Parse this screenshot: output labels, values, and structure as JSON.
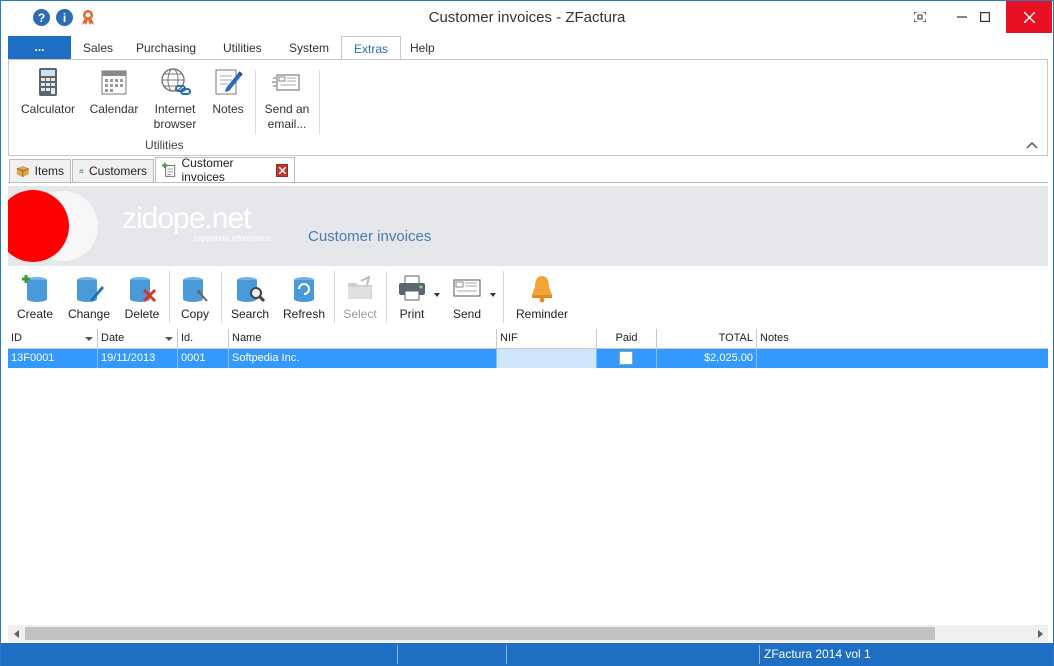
{
  "window": {
    "title": "Customer invoices - ZFactura"
  },
  "menu": {
    "file_label": "...",
    "items": [
      "Sales",
      "Purchasing",
      "Utilities",
      "System",
      "Extras",
      "Help"
    ],
    "active": "Extras"
  },
  "ribbon": {
    "buttons": [
      {
        "label": "Calculator"
      },
      {
        "label": "Calendar"
      },
      {
        "label": "Internet browser"
      },
      {
        "label": "Notes"
      },
      {
        "label": "Send an email..."
      }
    ],
    "group_label": "Utilities"
  },
  "doc_tabs": [
    {
      "label": "Items"
    },
    {
      "label": "Customers"
    },
    {
      "label": "Customer invoices"
    }
  ],
  "banner": {
    "logo_text": "zidope.net",
    "logo_sub": "ingeniería informática",
    "title": "Customer invoices"
  },
  "toolbar": {
    "buttons": [
      {
        "label": "Create"
      },
      {
        "label": "Change"
      },
      {
        "label": "Delete"
      },
      {
        "label": "Copy"
      },
      {
        "label": "Search"
      },
      {
        "label": "Refresh"
      },
      {
        "label": "Select"
      },
      {
        "label": "Print"
      },
      {
        "label": "Send"
      },
      {
        "label": "Reminder"
      }
    ]
  },
  "grid": {
    "columns": [
      "ID",
      "Date",
      "Id.",
      "Name",
      "NIF",
      "Paid",
      "TOTAL",
      "Notes"
    ],
    "rows": [
      {
        "id": "13F0001",
        "date": "19/11/2013",
        "idn": "0001",
        "name": "Softpedia Inc.",
        "nif": "",
        "paid": false,
        "total": "$2,025.00",
        "notes": ""
      }
    ]
  },
  "status": {
    "text": "ZFactura 2014 vol 1"
  },
  "colors": {
    "accent": "#1e6fc4",
    "selection": "#3399ff",
    "close": "#e81123"
  }
}
